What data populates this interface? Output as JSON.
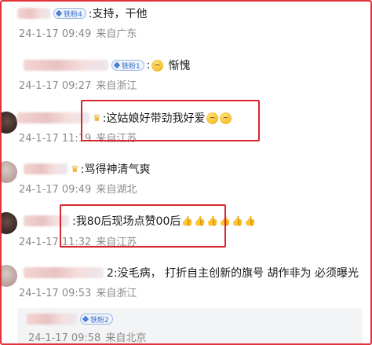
{
  "comments": [
    {
      "badge": "铁粉4",
      "text": ":支持，干他",
      "date": "24-1-17 09:49",
      "location": "来自广东"
    },
    {
      "badge": "铁粉1",
      "text": ":",
      "tail": "惭愧",
      "date": "24-1-17 09:27",
      "location": "来自浙江"
    },
    {
      "text": ":这姑娘好带劲我好爱",
      "date": "24-1-17 11:19",
      "location": "来自江苏"
    },
    {
      "text": ":骂得神清气爽",
      "date": "24-1-17 09:49",
      "location": "来自湖北"
    },
    {
      "text": ":我80后现场点赞00后",
      "date": "24-1-17 11:32",
      "location": "来自江苏"
    },
    {
      "text": "2:没毛病， 打折自主创新的旗号 胡作非为 必须曝光",
      "date": "24-1-17 09:53",
      "location": "来自浙江"
    }
  ],
  "reply": {
    "badge": "铁粉2",
    "date": "24-1-17 09:58",
    "location": "来自北京"
  },
  "colors": {
    "highlight": "#d7262f",
    "meta": "#8a8a8a",
    "badge": "#3b6fc6"
  },
  "icons": [
    "crown-icon",
    "emoji-icon",
    "thumbs-up-icon",
    "fan-badge-icon"
  ]
}
